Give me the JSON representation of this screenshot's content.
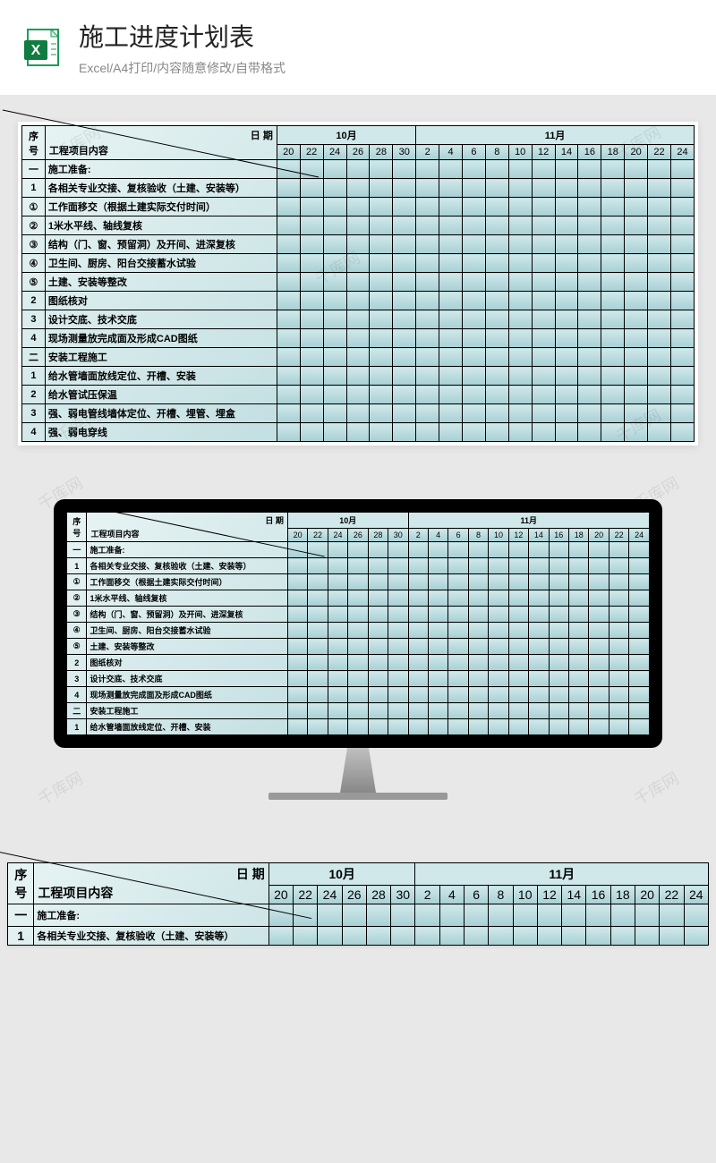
{
  "header": {
    "title": "施工进度计划表",
    "subtitle": "Excel/A4打印/内容随意修改/自带格式",
    "icon_name": "excel-icon"
  },
  "watermark_text": "千库网",
  "table": {
    "seq_label": "序号",
    "content_label": "工程项目内容",
    "date_label": "日 期",
    "months": [
      {
        "name": "10月",
        "days": [
          "20",
          "22",
          "24",
          "26",
          "28",
          "30"
        ]
      },
      {
        "name": "11月",
        "days": [
          "2",
          "4",
          "6",
          "8",
          "10",
          "12",
          "14",
          "16",
          "18",
          "20",
          "22",
          "24"
        ]
      }
    ],
    "rows": [
      {
        "seq": "一",
        "content": "施工准备:",
        "bold": true
      },
      {
        "seq": "1",
        "content": "各相关专业交接、复核验收（土建、安装等）"
      },
      {
        "seq": "①",
        "content": "工作面移交（根据土建实际交付时间）"
      },
      {
        "seq": "②",
        "content": "1米水平线、轴线复核"
      },
      {
        "seq": "③",
        "content": "结构（门、窗、预留洞）及开间、进深复核"
      },
      {
        "seq": "④",
        "content": "卫生间、厨房、阳台交接蓄水试验"
      },
      {
        "seq": "⑤",
        "content": "土建、安装等整改"
      },
      {
        "seq": "2",
        "content": "图纸核对"
      },
      {
        "seq": "3",
        "content": "设计交底、技术交底"
      },
      {
        "seq": "4",
        "content": "现场测量放完成面及形成CAD图纸"
      },
      {
        "seq": "二",
        "content": "安装工程施工",
        "bold": true
      },
      {
        "seq": "1",
        "content": "给水管墙面放线定位、开槽、安装"
      },
      {
        "seq": "2",
        "content": "给水管试压保温"
      },
      {
        "seq": "3",
        "content": "强、弱电管线墙体定位、开槽、埋管、埋盒"
      },
      {
        "seq": "4",
        "content": "强、弱电穿线"
      }
    ],
    "rows_monitor_limit": 12,
    "rows_bottom": [
      {
        "seq": "一",
        "content": "施工准备:",
        "bold": true
      },
      {
        "seq": "1",
        "content": "各相关专业交接、复核验收（土建、安装等）"
      }
    ]
  }
}
